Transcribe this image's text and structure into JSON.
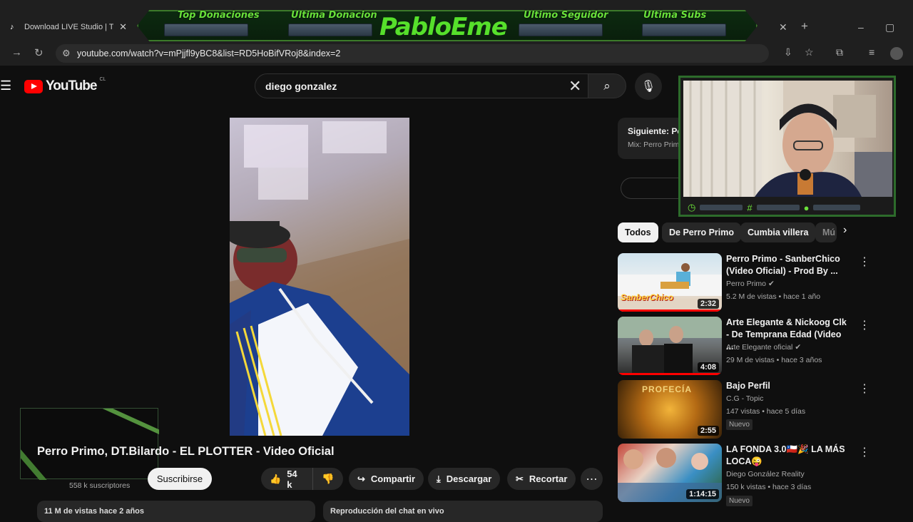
{
  "browser": {
    "tab_title": "Download LIVE Studio | Tik",
    "url": "youtube.com/watch?v=mPjjfl9yBC8&list=RD5HoBifVRoj8&index=2"
  },
  "overlay": {
    "labels": [
      "Top Donaciones",
      "Ultima Donacion",
      "Ultimo Seguidor",
      "Ultima Subs"
    ],
    "streamer": "PabloEme"
  },
  "header": {
    "logo": "YouTube",
    "country": "CL",
    "search_query": "diego gonzalez"
  },
  "video": {
    "title": "Perro Primo, DT.Bilardo - EL PLOTTER - Video Oficial",
    "subscribers": "558 k suscriptores",
    "subscribe_label": "Suscribirse",
    "likes": "54 k",
    "share_label": "Compartir",
    "download_label": "Descargar",
    "clip_label": "Recortar",
    "views_line": "11 M de vistas  hace 2 años",
    "chat_line": "Reproducción del chat en vivo"
  },
  "up_next": {
    "label": "Siguiente: Perro Primo",
    "mix": "Mix: Perro Prim"
  },
  "chips": [
    "Todos",
    "De Perro Primo",
    "Cumbia villera",
    "Mú"
  ],
  "recommendations": [
    {
      "title": "Perro Primo - SanberChico (Video Oficial) -  Prod By ...",
      "channel": "Perro Primo",
      "verified": true,
      "meta": "5.2 M de vistas • hace 1 año",
      "duration": "2:32",
      "badge": "",
      "thumb_text": "SanberChico",
      "progress": 1.0
    },
    {
      "title": "Arte Elegante  & Nickoog Clk - De Temprana Edad (Video ...",
      "channel": "Arte Elegante oficial",
      "verified": true,
      "meta": "29 M de vistas • hace 3 años",
      "duration": "4:08",
      "badge": "",
      "thumb_text": "",
      "progress": 1.0
    },
    {
      "title": "Bajo Perfil",
      "channel": "C.G - Topic",
      "verified": false,
      "meta": "147 vistas • hace 5 días",
      "duration": "2:55",
      "badge": "Nuevo",
      "thumb_text": "PROFECÍA",
      "progress": 0
    },
    {
      "title": "LA FONDA 3.0🇨🇱🎉 LA MÁS LOCA😜",
      "channel": "Diego González Reality",
      "verified": false,
      "meta": "150 k vistas • hace 3 días",
      "duration": "1:14:15",
      "badge": "Nuevo",
      "thumb_text": "",
      "progress": 0
    }
  ],
  "colors": {
    "accent": "#ff0000",
    "overlay_green": "#56e02b",
    "background": "#0f0f0f"
  }
}
